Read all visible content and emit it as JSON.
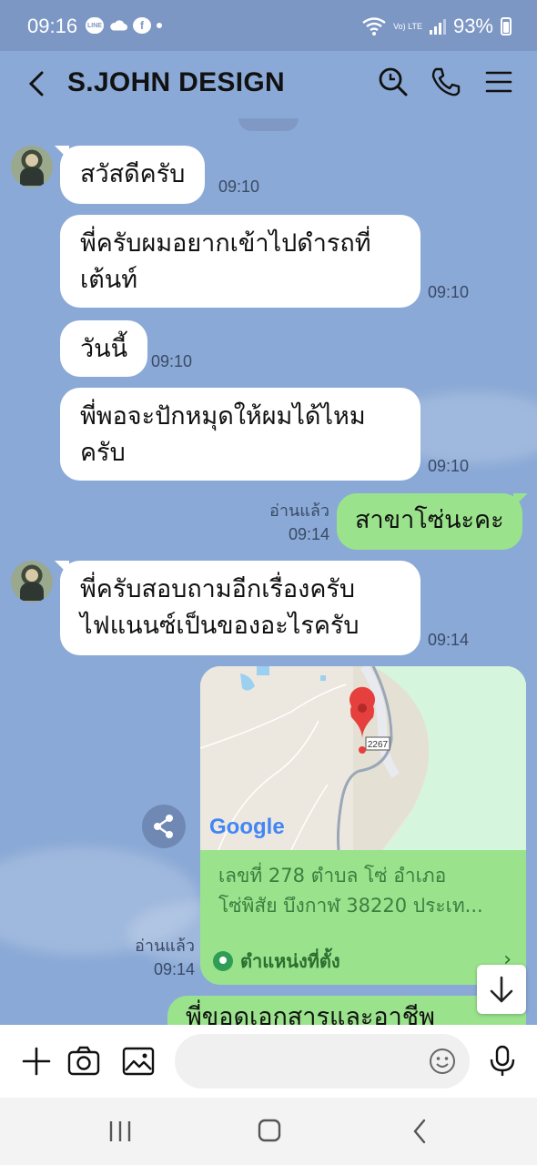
{
  "status_bar": {
    "time": "09:16",
    "line_icon_text": "LINE",
    "battery": "93%",
    "network": "Vo) LTE"
  },
  "header": {
    "title": "S.JOHN DESIGN"
  },
  "messages": [
    {
      "text": "สวัสดีครับ",
      "time": "09:10"
    },
    {
      "text_line1": "พี่ครับผมอยากเข้าไปดำรถที่",
      "text_line2": "เต้นท์",
      "time": "09:10"
    },
    {
      "text": "วันนี้",
      "time": "09:10"
    },
    {
      "text_line1": "พี่พอจะปักหมุดให้ผมได้ไหม",
      "text_line2": "ครับ",
      "time": "09:10"
    },
    {
      "text": "สาขาโซ่นะคะ",
      "time": "09:14",
      "read": "อ่านแล้ว"
    },
    {
      "text_line1": "พี่ครับสอบถามอีกเรื่องครับ",
      "text_line2": "ไฟแนนซ์เป็นของอะไรครับ",
      "time": "09:14"
    },
    {
      "text": "พี่ขอดูเอกสารและอาชีพ"
    }
  ],
  "location": {
    "address_line1": "เลขที่ 278 ตำบล โซ่ อำเภอ",
    "address_line2": "โซ่พิสัย บึงกาฬ 38220 ประเท...",
    "label": "ตำแหน่งที่ตั้ง",
    "read": "อ่านแล้ว",
    "time": "09:14",
    "map_road_label": "2267",
    "map_brand": "Google"
  },
  "input": {
    "placeholder": ""
  },
  "colors": {
    "chat_bg": "#8aa9d6",
    "mine_bubble": "#9ae38c",
    "their_bubble": "#ffffff"
  }
}
